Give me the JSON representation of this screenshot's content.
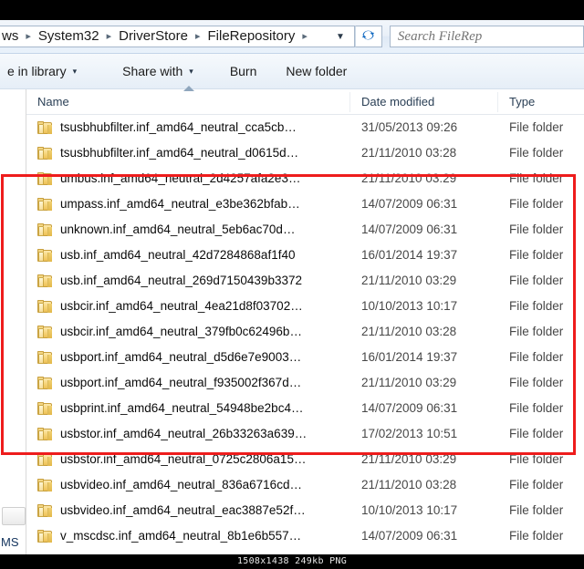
{
  "window": {
    "title": "FileRepository"
  },
  "address_bar": {
    "breadcrumbs": [
      {
        "label": "ws"
      },
      {
        "label": "System32"
      },
      {
        "label": "DriverStore"
      },
      {
        "label": "FileRepository"
      }
    ],
    "separator": "▸",
    "dropdown_caret": "▼",
    "refresh_icon": "refresh-icon",
    "refresh_glyph": "↻"
  },
  "search": {
    "placeholder": "Search FileRep",
    "value": "",
    "icon": "search-icon"
  },
  "toolbar": {
    "items": [
      {
        "label": "e in library",
        "has_caret": true
      },
      {
        "label": "Share with",
        "has_caret": true
      },
      {
        "label": "Burn",
        "has_caret": false
      },
      {
        "label": "New folder",
        "has_caret": false
      }
    ],
    "caret": "▾"
  },
  "nav_pane": {
    "truncated_label": "MS"
  },
  "file_list": {
    "columns": [
      {
        "key": "name",
        "label": "Name",
        "sorted": "asc"
      },
      {
        "key": "date",
        "label": "Date modified",
        "sorted": null
      },
      {
        "key": "type",
        "label": "Type",
        "sorted": null
      }
    ],
    "sort_indicator": "sort-ascending-icon",
    "rows": [
      {
        "name": "tsusbhubfilter.inf_amd64_neutral_cca5cb…",
        "date": "31/05/2013 09:26",
        "type": "File folder",
        "highlighted": false
      },
      {
        "name": "tsusbhubfilter.inf_amd64_neutral_d0615d…",
        "date": "21/11/2010 03:28",
        "type": "File folder",
        "highlighted": false
      },
      {
        "name": "umbus.inf_amd64_neutral_2d4257afa2e3…",
        "date": "21/11/2010 03:29",
        "type": "File folder",
        "highlighted": false
      },
      {
        "name": "umpass.inf_amd64_neutral_e3be362bfab…",
        "date": "14/07/2009 06:31",
        "type": "File folder",
        "highlighted": false
      },
      {
        "name": "unknown.inf_amd64_neutral_5eb6ac70d…",
        "date": "14/07/2009 06:31",
        "type": "File folder",
        "highlighted": false
      },
      {
        "name": "usb.inf_amd64_neutral_42d7284868af1f40",
        "date": "16/01/2014 19:37",
        "type": "File folder",
        "highlighted": true
      },
      {
        "name": "usb.inf_amd64_neutral_269d7150439b3372",
        "date": "21/11/2010 03:29",
        "type": "File folder",
        "highlighted": true
      },
      {
        "name": "usbcir.inf_amd64_neutral_4ea21d8f03702…",
        "date": "10/10/2013 10:17",
        "type": "File folder",
        "highlighted": true
      },
      {
        "name": "usbcir.inf_amd64_neutral_379fb0c62496b…",
        "date": "21/11/2010 03:28",
        "type": "File folder",
        "highlighted": true
      },
      {
        "name": "usbport.inf_amd64_neutral_d5d6e7e9003…",
        "date": "16/01/2014 19:37",
        "type": "File folder",
        "highlighted": true
      },
      {
        "name": "usbport.inf_amd64_neutral_f935002f367d…",
        "date": "21/11/2010 03:29",
        "type": "File folder",
        "highlighted": true
      },
      {
        "name": "usbprint.inf_amd64_neutral_54948be2bc4…",
        "date": "14/07/2009 06:31",
        "type": "File folder",
        "highlighted": true
      },
      {
        "name": "usbstor.inf_amd64_neutral_26b33263a639…",
        "date": "17/02/2013 10:51",
        "type": "File folder",
        "highlighted": true
      },
      {
        "name": "usbstor.inf_amd64_neutral_0725c2806a15…",
        "date": "21/11/2010 03:29",
        "type": "File folder",
        "highlighted": true
      },
      {
        "name": "usbvideo.inf_amd64_neutral_836a6716cd…",
        "date": "21/11/2010 03:28",
        "type": "File folder",
        "highlighted": true
      },
      {
        "name": "usbvideo.inf_amd64_neutral_eac3887e52f…",
        "date": "10/10/2013 10:17",
        "type": "File folder",
        "highlighted": true
      },
      {
        "name": "v_mscdsc.inf_amd64_neutral_8b1e6b557…",
        "date": "14/07/2009 06:31",
        "type": "File folder",
        "highlighted": false
      }
    ]
  },
  "annotation": {
    "type": "red-rectangle",
    "color": "#ee1c1c",
    "first_row_index": 5,
    "last_row_index": 15
  },
  "caption": {
    "text": "1508x1438 249kb PNG"
  }
}
